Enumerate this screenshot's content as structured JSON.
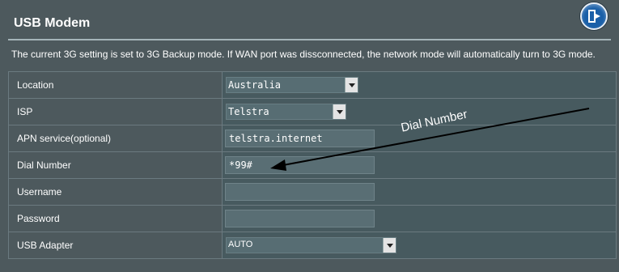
{
  "page": {
    "title": "USB Modem",
    "description": "The current 3G setting is set to 3G Backup mode. If WAN port was dissconnected, the network mode will automatically turn to 3G mode."
  },
  "form": {
    "location": {
      "label": "Location",
      "value": "Australia"
    },
    "isp": {
      "label": "ISP",
      "value": "Telstra"
    },
    "apn": {
      "label": "APN service(optional)",
      "value": "telstra.internet"
    },
    "dial": {
      "label": "Dial Number",
      "value": "*99#"
    },
    "username": {
      "label": "Username",
      "value": ""
    },
    "password": {
      "label": "Password",
      "value": ""
    },
    "adapter": {
      "label": "USB Adapter",
      "value": "AUTO"
    }
  },
  "annotation": {
    "text": "Dial Number"
  },
  "colors": {
    "background": "#4d595d",
    "accent": "#1a5fa8"
  },
  "icons": {
    "back": "exit-door-icon"
  }
}
